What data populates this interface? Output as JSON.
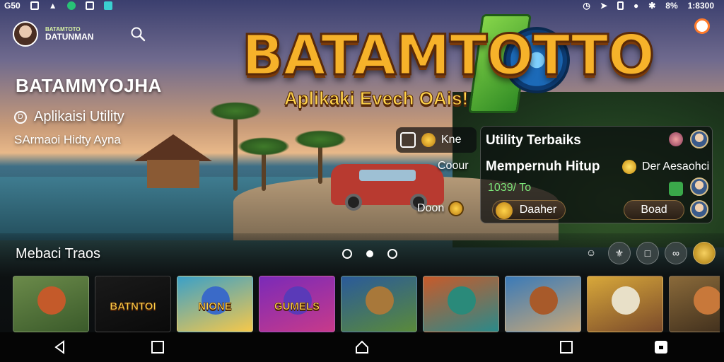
{
  "statusbar": {
    "left_text": "G50",
    "right_text": "1:8300",
    "battery_text": "8%"
  },
  "header": {
    "profile_sub": "BATAMTOTO",
    "profile_name": "DATUNMAN"
  },
  "hero": {
    "title": "BATAMMYOJHA",
    "subtitle": "Aplikaisi Utility",
    "subtitle_icon": "D",
    "caption": "SArmaoi Hidty Ayna"
  },
  "logo": {
    "main": "BATAMTOTTO",
    "tagline": "Aplikaki Evech OAis!"
  },
  "mini_card": {
    "label": "Kne"
  },
  "middle": {
    "label1": "Coour",
    "label2": "Doon"
  },
  "panel": {
    "title": "Utility Terbaiks",
    "row2": "Mempernuh Hitup",
    "secondary": "Der Aesaohci",
    "stat": "1039/ To",
    "button_deal": "Daaher",
    "button_board": "Boad"
  },
  "section": {
    "title": "Mebaci Traos"
  },
  "carousel": {
    "pages": 3,
    "active_index": 1
  },
  "thumbs": [
    {
      "label": "",
      "colors": [
        "#6b8a4a",
        "#3a5a2a"
      ],
      "face": "#c45a2a"
    },
    {
      "label": "BATNTOI",
      "colors": [
        "#1a1a1a",
        "#0a0a0a"
      ],
      "face": "transparent"
    },
    {
      "label": "NIONE",
      "colors": [
        "#3aa0c8",
        "#f6c84a"
      ],
      "face": "#3a6ac8"
    },
    {
      "label": "GUMELS",
      "colors": [
        "#7a2ab8",
        "#c83a8a"
      ],
      "face": "#5a3ab8"
    },
    {
      "label": "",
      "colors": [
        "#2a5a9a",
        "#5a8a3a"
      ],
      "face": "#a8783a"
    },
    {
      "label": "",
      "colors": [
        "#c85a2a",
        "#2a8a8a"
      ],
      "face": "#2a8a7a"
    },
    {
      "label": "",
      "colors": [
        "#3a7ab8",
        "#c8a878"
      ],
      "face": "#a85a2a"
    },
    {
      "label": "",
      "colors": [
        "#d8a83a",
        "#7a4a2a"
      ],
      "face": "#e8e0c8"
    },
    {
      "label": "",
      "colors": [
        "#8a6a3a",
        "#3a2a1a"
      ],
      "face": "#c8783a"
    }
  ],
  "colors": {
    "accent_gold": "#ffd34a",
    "logo_orange": "#f6b22a",
    "logo_green": "#86d64a",
    "panel_bg": "#0a0c0e",
    "stat_green": "#7de87a"
  },
  "icons": {
    "status": [
      "sim-icon",
      "photo-icon",
      "signal-icon",
      "app-dot-icon",
      "save-icon",
      "link-icon"
    ],
    "status_right": [
      "clock-icon",
      "location-icon",
      "battery-icon",
      "wifi-icon",
      "bluetooth-icon"
    ],
    "nav": [
      "back-icon",
      "home-icon",
      "recents-icon",
      "screenshot-icon"
    ]
  }
}
